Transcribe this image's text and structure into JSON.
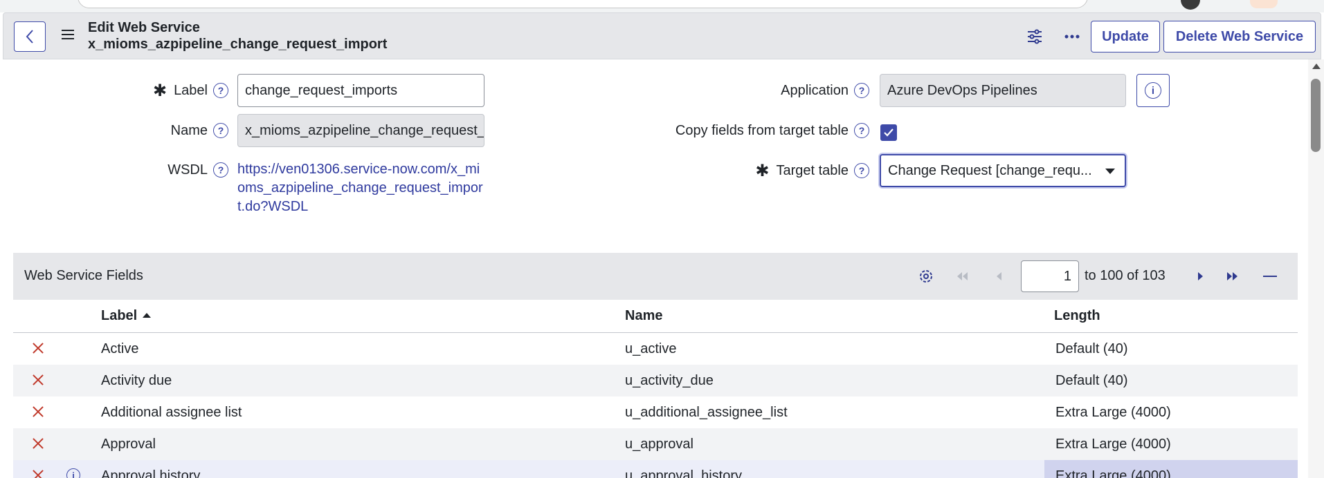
{
  "header": {
    "title_line1": "Edit Web Service",
    "title_line2": "x_mioms_azpipeline_change_request_import",
    "update_label": "Update",
    "delete_label": "Delete Web Service",
    "icons": [
      "back-icon",
      "menu-icon",
      "settings-sliders-icon",
      "more-icon"
    ]
  },
  "form": {
    "label": {
      "label": "Label",
      "value": "change_request_imports",
      "required": true
    },
    "name": {
      "label": "Name",
      "value": "x_mioms_azpipeline_change_request_import"
    },
    "wsdl": {
      "label": "WSDL",
      "value": "https://ven01306.service-now.com/x_mioms_azpipeline_change_request_import.do?WSDL"
    },
    "application": {
      "label": "Application",
      "value": "Azure DevOps Pipelines"
    },
    "copy_fields": {
      "label": "Copy fields from target table",
      "checked": true
    },
    "target_table": {
      "label": "Target table",
      "value": "Change Request [change_requ...",
      "required": true
    }
  },
  "list": {
    "title": "Web Service Fields",
    "page_value": "1",
    "page_info": "to 100 of 103",
    "columns": {
      "label": "Label",
      "name": "Name",
      "length": "Length"
    },
    "rows": [
      {
        "label": "Active",
        "name": "u_active",
        "length": "Default (40)"
      },
      {
        "label": "Activity due",
        "name": "u_activity_due",
        "length": "Default (40)"
      },
      {
        "label": "Additional assignee list",
        "name": "u_additional_assignee_list",
        "length": "Extra Large (4000)"
      },
      {
        "label": "Approval",
        "name": "u_approval",
        "length": "Extra Large (4000)"
      },
      {
        "label": "Approval history",
        "name": "u_approval_history",
        "length": "Extra Large (4000)"
      }
    ]
  },
  "colors": {
    "accent": "#3e4aa8",
    "delete": "#c0392b",
    "header_bg": "#e6e7ea"
  }
}
